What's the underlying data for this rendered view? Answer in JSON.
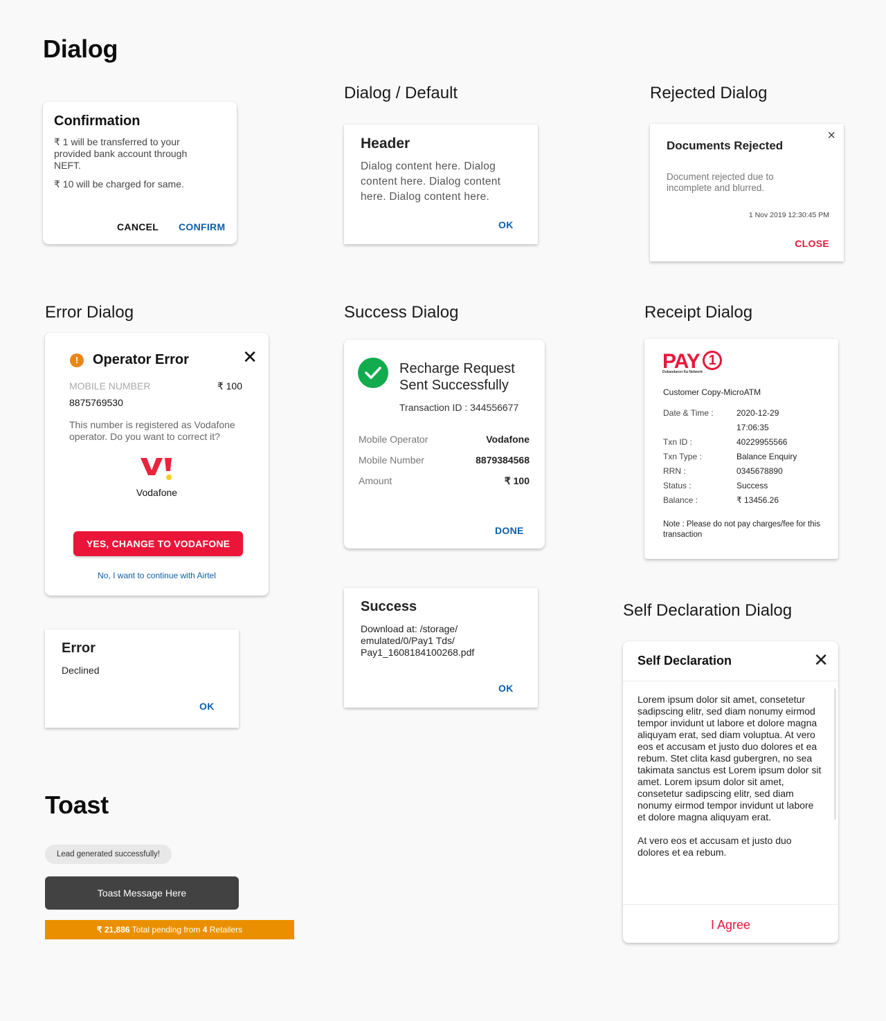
{
  "page": {
    "title": "Dialog",
    "sections": {
      "default": "Dialog / Default",
      "rejected": "Rejected Dialog",
      "error": "Error Dialog",
      "success": "Success Dialog",
      "receipt": "Receipt Dialog",
      "self_declaration": "Self Declaration Dialog",
      "toast": "Toast"
    }
  },
  "confirmation_dialog": {
    "title": "Confirmation",
    "line1": "₹ 1 will be transferred to your provided bank account through NEFT.",
    "line2": "₹ 10 will be charged for same.",
    "cancel_label": "CANCEL",
    "confirm_label": "CONFIRM"
  },
  "default_dialog": {
    "title": "Header",
    "content": "Dialog content here. Dialog content here. Dialog content here. Dialog content here.",
    "ok_label": "OK"
  },
  "rejected_dialog": {
    "title": "Documents Rejected",
    "message": "Document rejected due to incomplete and blurred.",
    "timestamp": "1 Nov 2019 12:30:45 PM",
    "close_label": "CLOSE",
    "close_icon": "×"
  },
  "operator_error_dialog": {
    "title": "Operator Error",
    "warning_icon": "!",
    "close_icon": "✕",
    "mobile_label": "MOBILE NUMBER",
    "amount": "₹ 100",
    "mobile_number": "8875769530",
    "message": "This number is registered as Vodafone operator. Do you want to correct it?",
    "operator_name": "Vodafone",
    "primary_label": "YES, CHANGE TO VODAFONE",
    "secondary_label": "No, I want to continue with Airtel"
  },
  "error_dialog": {
    "title": "Error",
    "message": "Declined",
    "ok_label": "OK"
  },
  "recharge_success_dialog": {
    "title": "Recharge Request Sent Successfully",
    "transaction": "Transaction ID : 344556677",
    "rows": [
      {
        "label": "Mobile Operator",
        "value": "Vodafone"
      },
      {
        "label": "Mobile Number",
        "value": "8879384568"
      },
      {
        "label": "Amount",
        "value": "₹ 100"
      }
    ],
    "done_label": "DONE"
  },
  "download_success_dialog": {
    "title": "Success",
    "message": "Download at: /storage/ emulated/0/Pay1 Tds/ Pay1_1608184100268.pdf",
    "ok_label": "OK"
  },
  "receipt_dialog": {
    "logo_text": "PAY",
    "logo_tagline": "Dukandaron Ka Network",
    "subtitle": "Customer Copy-MicroATM",
    "rows": [
      {
        "label": "Date & Time :",
        "value": "2020-12-29"
      },
      {
        "label": "",
        "value": "17:06:35"
      },
      {
        "label": "Txn ID :",
        "value": "40229955566"
      },
      {
        "label": "Txn Type :",
        "value": "Balance Enquiry"
      },
      {
        "label": "RRN :",
        "value": "0345678890"
      },
      {
        "label": "Status :",
        "value": "Success"
      },
      {
        "label": "Balance :",
        "value": "₹ 13456.26"
      }
    ],
    "note": "Note : Please do not pay charges/fee for this transaction"
  },
  "self_declaration_dialog": {
    "title": "Self Declaration",
    "close_icon": "✕",
    "paragraph1": "Lorem ipsum dolor sit amet, consetetur sadipscing elitr, sed diam nonumy eirmod tempor invidunt ut labore et dolore magna aliquyam erat, sed diam voluptua. At vero eos et accusam et justo duo dolores et ea rebum. Stet clita kasd gubergren, no sea takimata sanctus est Lorem ipsum dolor sit amet. Lorem ipsum dolor sit amet, consetetur sadipscing elitr, sed diam nonumy eirmod tempor invidunt ut labore et dolore magna aliquyam erat.",
    "paragraph2": "At vero eos et accusam et justo duo dolores et ea rebum.",
    "agree_label": "I Agree"
  },
  "toasts": {
    "light": "Lead generated successfully!",
    "dark": "Toast Message Here",
    "banner": {
      "amount": "₹ 21,886",
      "text1": " Total pending from ",
      "count": "4",
      "text2": " Retailers"
    }
  },
  "colors": {
    "primary_blue": "#0b5eaa",
    "accent_red": "#e8173b",
    "success_green": "#12ab4e",
    "warning_orange": "#e9861a",
    "banner_orange": "#ea9000",
    "toast_dark": "#424242"
  }
}
